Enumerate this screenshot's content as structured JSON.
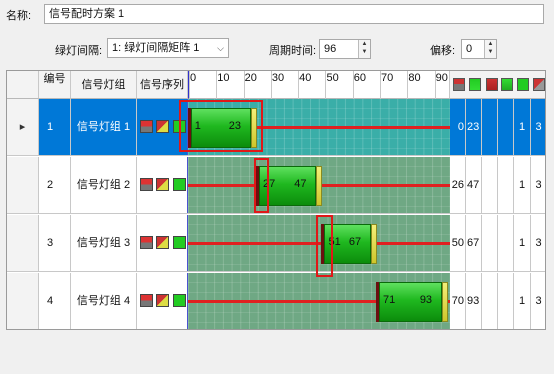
{
  "form": {
    "name_label": "名称:",
    "name_value": "信号配时方案 1",
    "interval_label": "绿灯间隔:",
    "interval_value": "1: 绿灯间隔矩阵 1",
    "cycle_label": "周期时间:",
    "cycle_value": "96",
    "offset_label": "偏移:",
    "offset_value": "0"
  },
  "grid": {
    "headers": {
      "number": "编号",
      "group": "信号灯组",
      "sequence": "信号序列",
      "ticks": [
        "0",
        "10",
        "20",
        "30",
        "40",
        "50",
        "60",
        "70",
        "80",
        "90"
      ]
    },
    "header_icons": [
      "red-amber-icon",
      "green-amber-icon",
      "red-icon",
      "green-down-icon",
      "green-icon",
      "red-flash-icon",
      "amber-flash-icon"
    ],
    "rows": [
      {
        "num": "1",
        "group": "信号灯组 1",
        "green_start": 1,
        "green_end": 23,
        "start_label": "1",
        "end_label": "23",
        "col_start": "0",
        "col_end": "23",
        "col_a": "1",
        "col_b": "3",
        "selected": true
      },
      {
        "num": "2",
        "group": "信号灯组 2",
        "green_start": 26,
        "green_end": 47,
        "start_label": "27",
        "end_label": "47",
        "col_start": "26",
        "col_end": "47",
        "col_a": "1",
        "col_b": "3",
        "selected": false
      },
      {
        "num": "3",
        "group": "信号灯组 3",
        "green_start": 50,
        "green_end": 67,
        "start_label": "51",
        "end_label": "67",
        "col_start": "50",
        "col_end": "67",
        "col_a": "1",
        "col_b": "3",
        "selected": false
      },
      {
        "num": "4",
        "group": "信号灯组 4",
        "green_start": 70,
        "green_end": 93,
        "start_label": "71",
        "end_label": "93",
        "col_start": "70",
        "col_end": "93",
        "col_a": "1",
        "col_b": "3",
        "selected": false
      }
    ],
    "cycle_seconds": 96
  },
  "colors": {
    "selection": "#0078d7",
    "timeline": "#6fa884",
    "green_bar": "#1fb81f",
    "red_line": "#e02020",
    "highlight": "#e01818"
  }
}
